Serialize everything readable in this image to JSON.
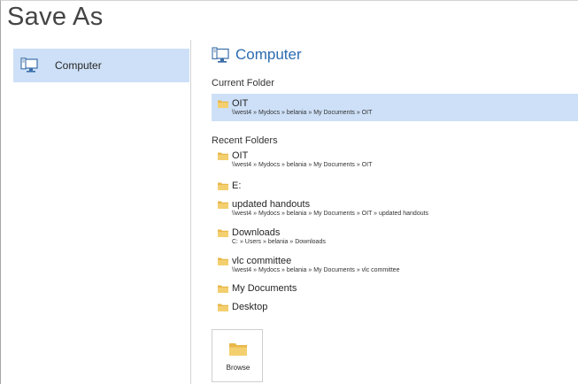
{
  "title": "Save As",
  "places": [
    {
      "label": "Computer",
      "icon": "computer-icon",
      "selected": true
    }
  ],
  "pane": {
    "heading": "Computer",
    "current_folder_label": "Current Folder",
    "current_folder": {
      "name": "OIT",
      "path": "\\\\west4 » Mydocs » belania » My Documents » OIT"
    },
    "recent_folders_label": "Recent Folders",
    "recent_folders": [
      {
        "name": "OIT",
        "path": "\\\\west4 » Mydocs » belania » My Documents » OIT"
      },
      {
        "name": "E:",
        "path": ""
      },
      {
        "name": "updated handouts",
        "path": "\\\\west4 » Mydocs » belania » My Documents » OIT » updated handouts"
      },
      {
        "name": "Downloads",
        "path": "C: » Users » belania » Downloads"
      },
      {
        "name": "vlc committee",
        "path": "\\\\west4 » Mydocs » belania » My Documents » vlc committee"
      },
      {
        "name": "My Documents",
        "path": ""
      },
      {
        "name": "Desktop",
        "path": ""
      }
    ]
  },
  "browse_label": "Browse",
  "colors": {
    "accent": "#2b6cb0",
    "selection": "#cde0f7",
    "folder": "#e8b84a"
  }
}
